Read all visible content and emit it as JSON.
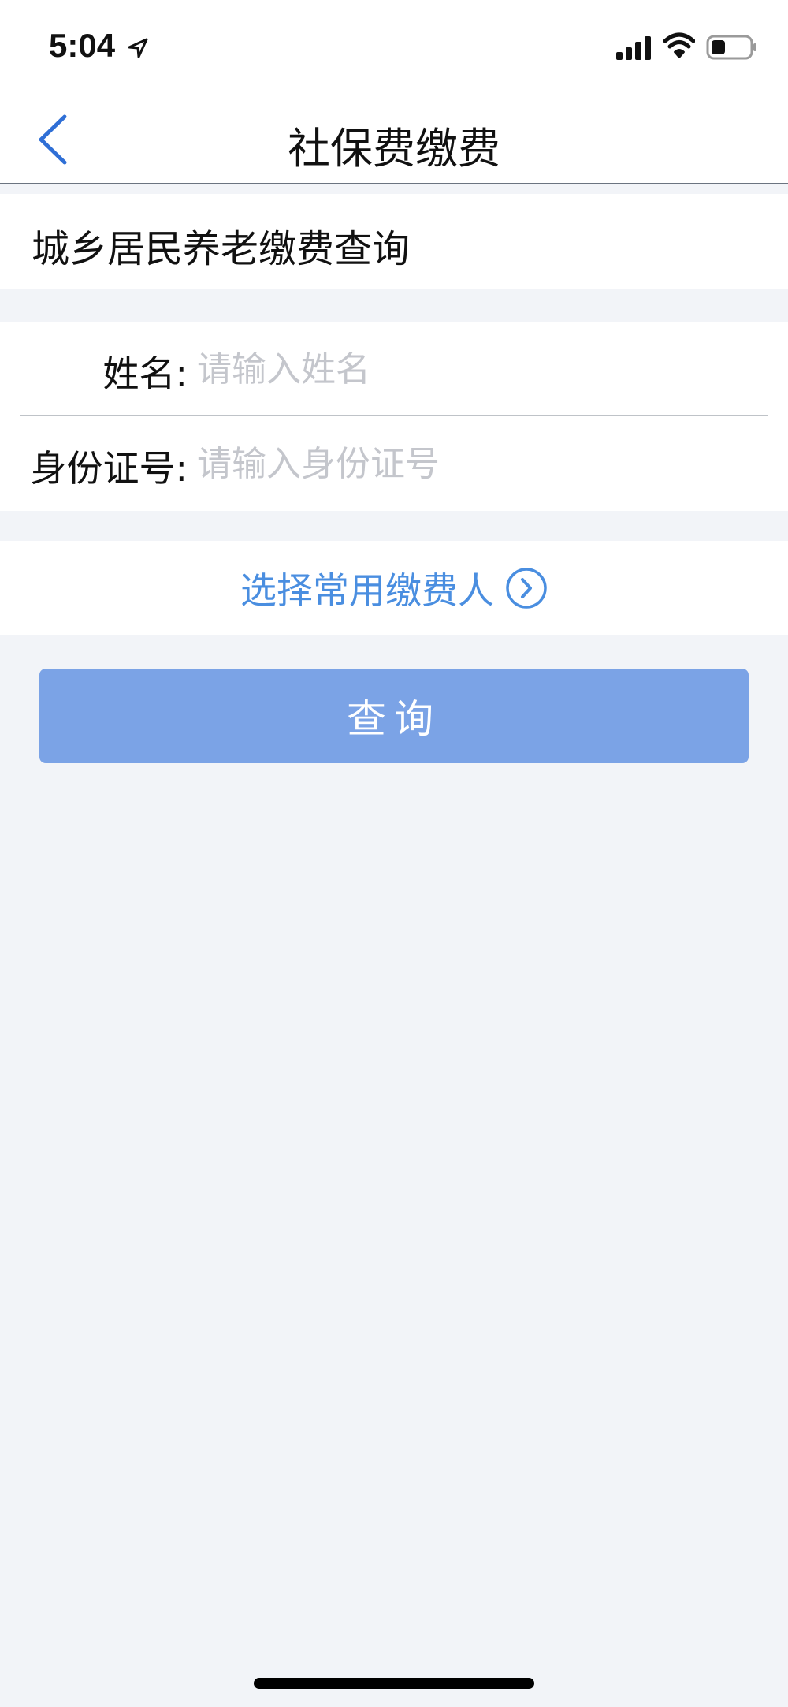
{
  "status_bar": {
    "time": "5:04"
  },
  "nav": {
    "title": "社保费缴费"
  },
  "section": {
    "title": "城乡居民养老缴费查询"
  },
  "form": {
    "name_label": "姓名:",
    "name_placeholder": "请输入姓名",
    "name_value": "",
    "id_label": "身份证号:",
    "id_placeholder": "请输入身份证号",
    "id_value": ""
  },
  "select_payer": {
    "label": "选择常用缴费人"
  },
  "query_button": {
    "label": "查询"
  },
  "colors": {
    "accent": "#4a8ee0",
    "button": "#7ba3e6",
    "background": "#f2f4f8",
    "placeholder": "#c4c6cc"
  },
  "icons": {
    "back": "chevron-left-icon",
    "location": "location-arrow-icon",
    "signal": "cellular-signal-icon",
    "wifi": "wifi-icon",
    "battery": "battery-icon",
    "select_payer": "chevron-right-circle-icon"
  }
}
